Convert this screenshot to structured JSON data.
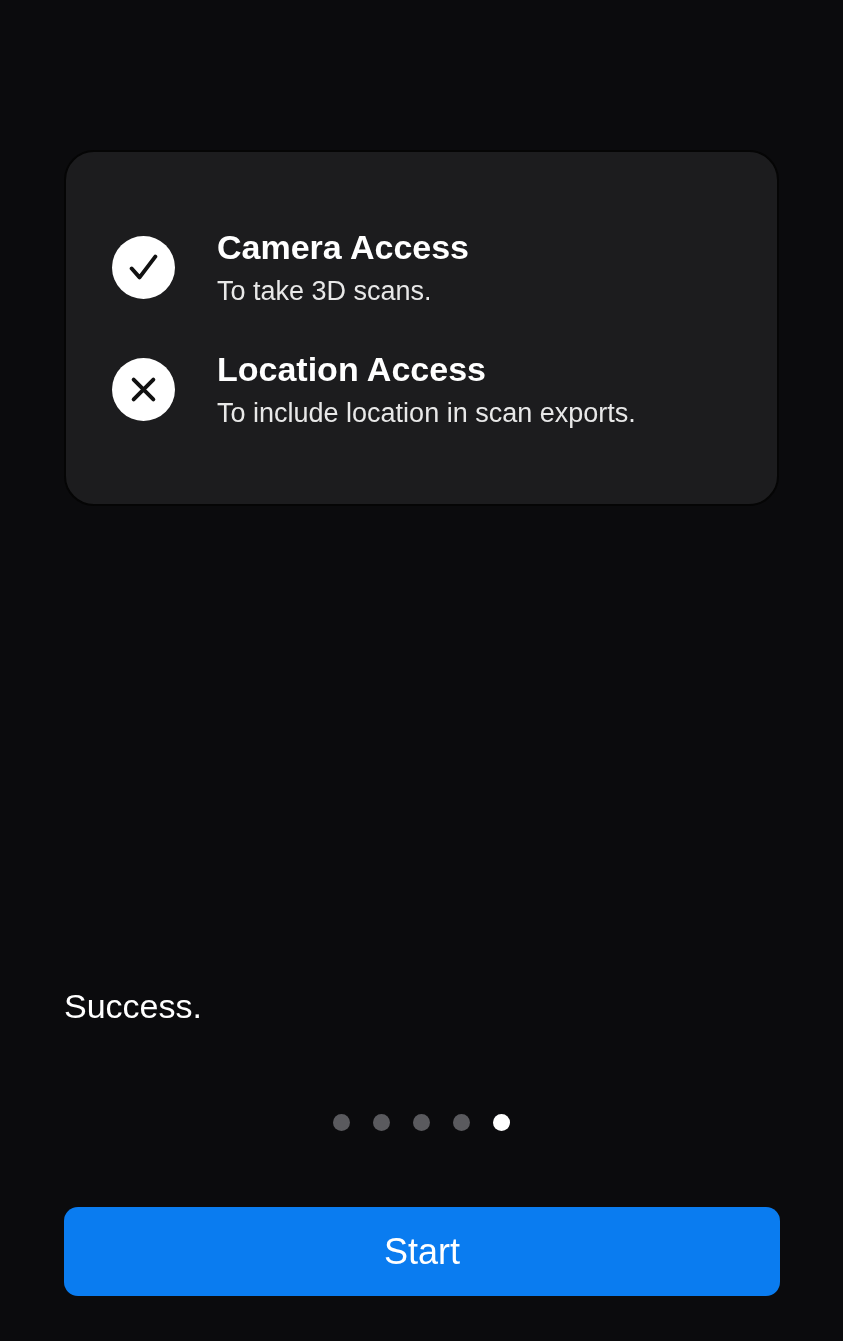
{
  "permissions": [
    {
      "title": "Camera Access",
      "description": "To take 3D scans.",
      "granted": true
    },
    {
      "title": "Location Access",
      "description": "To include location in scan exports.",
      "granted": false
    }
  ],
  "message": "Success.",
  "pages": [
    {
      "selected": false
    },
    {
      "selected": false
    },
    {
      "selected": false
    },
    {
      "selected": false
    },
    {
      "selected": true
    }
  ],
  "button": {
    "label": "Start"
  }
}
